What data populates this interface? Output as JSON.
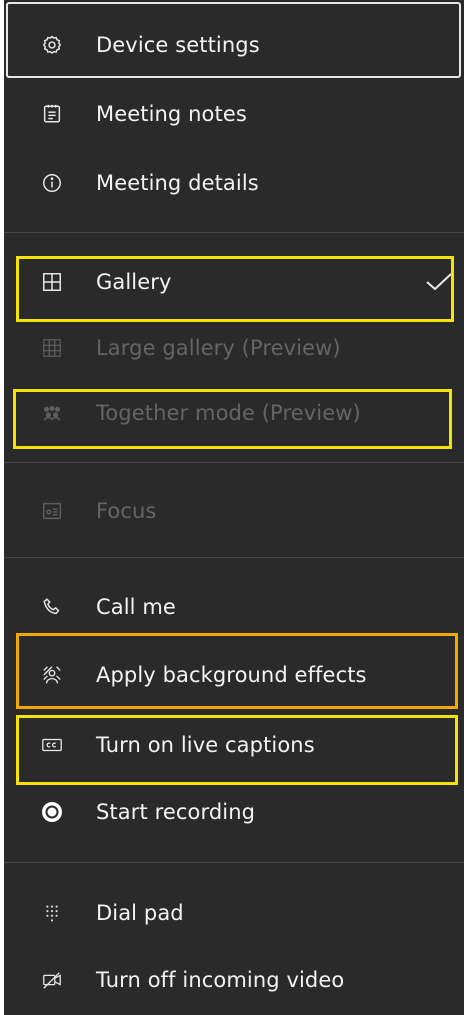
{
  "menu": {
    "items": [
      {
        "label": "Device settings",
        "icon": "gear-icon",
        "enabled": true
      },
      {
        "label": "Meeting notes",
        "icon": "notes-icon",
        "enabled": true
      },
      {
        "label": "Meeting details",
        "icon": "info-icon",
        "enabled": true
      },
      {
        "label": "Gallery",
        "icon": "gallery-grid-icon",
        "enabled": true,
        "checked": true
      },
      {
        "label": "Large gallery (Preview)",
        "icon": "large-gallery-icon",
        "enabled": false
      },
      {
        "label": "Together mode (Preview)",
        "icon": "together-mode-icon",
        "enabled": false
      },
      {
        "label": "Focus",
        "icon": "focus-icon",
        "enabled": false
      },
      {
        "label": "Call me",
        "icon": "phone-icon",
        "enabled": true
      },
      {
        "label": "Apply background effects",
        "icon": "background-effects-icon",
        "enabled": true
      },
      {
        "label": "Turn on live captions",
        "icon": "cc-icon",
        "enabled": true
      },
      {
        "label": "Start recording",
        "icon": "record-icon",
        "enabled": true
      },
      {
        "label": "Dial pad",
        "icon": "dialpad-icon",
        "enabled": true
      },
      {
        "label": "Turn off incoming video",
        "icon": "video-off-icon",
        "enabled": true
      }
    ]
  },
  "colors": {
    "menu_background": "#2a2a2a",
    "text": "#f3f3f3",
    "disabled_text": "#656565",
    "highlight_yellow": "#f5e400",
    "highlight_orange": "#f2a900"
  }
}
